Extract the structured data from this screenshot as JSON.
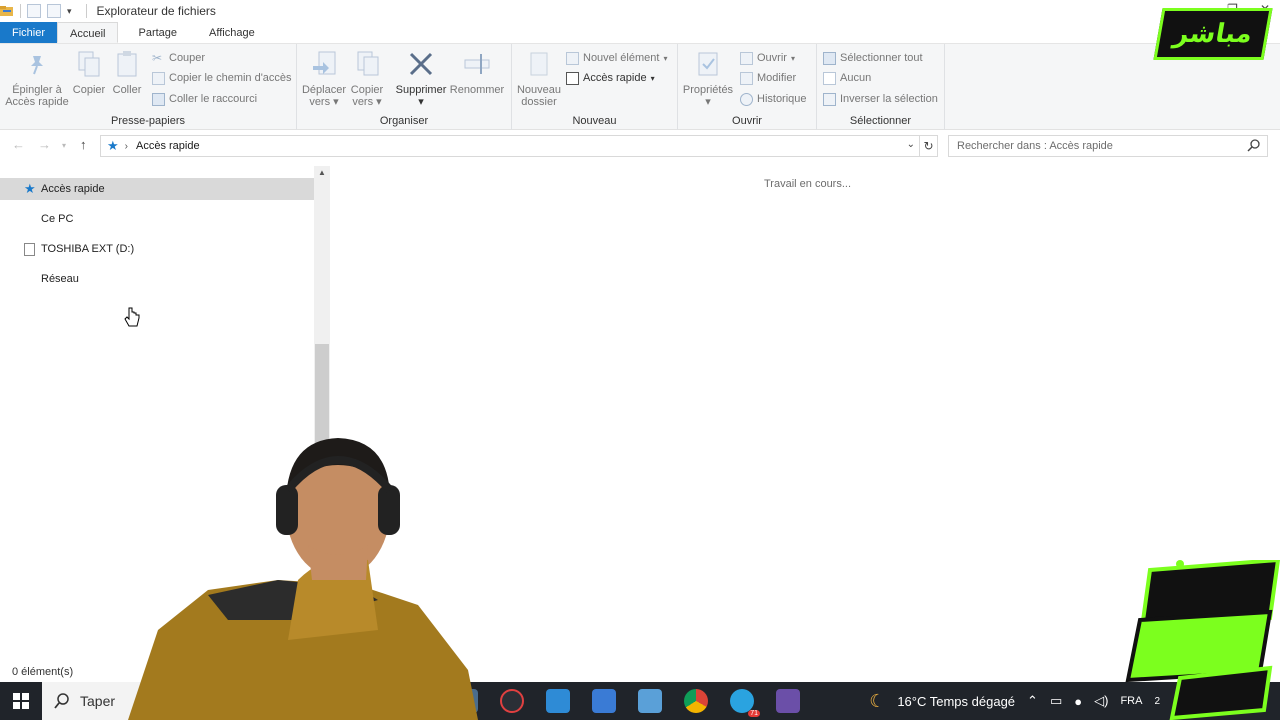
{
  "window": {
    "title": "Explorateur de fichiers"
  },
  "tabs": [
    {
      "label": "Fichier"
    },
    {
      "label": "Accueil"
    },
    {
      "label": "Partage"
    },
    {
      "label": "Affichage"
    }
  ],
  "ribbon": {
    "presse_papiers": {
      "label": "Presse-papiers",
      "pin_label_1": "Épingler à",
      "pin_label_2": "Accès rapide",
      "copy": "Copier",
      "paste": "Coller",
      "cut": "Couper",
      "copy_path": "Copier le chemin d'accès",
      "paste_shortcut": "Coller le raccourci"
    },
    "organiser": {
      "label": "Organiser",
      "move_1": "Déplacer",
      "move_2": "vers",
      "copyto_1": "Copier",
      "copyto_2": "vers",
      "delete": "Supprimer",
      "rename": "Renommer"
    },
    "nouveau": {
      "label": "Nouveau",
      "new_folder_1": "Nouveau",
      "new_folder_2": "dossier",
      "new_item": "Nouvel élément",
      "easy_access": "Accès rapide"
    },
    "ouvrir": {
      "label": "Ouvrir",
      "properties": "Propriétés",
      "open": "Ouvrir",
      "edit": "Modifier",
      "history": "Historique"
    },
    "selectionner": {
      "label": "Sélectionner",
      "select_all": "Sélectionner tout",
      "select_none": "Aucun",
      "invert": "Inverser la sélection"
    }
  },
  "addressbar": {
    "path": "Accès rapide",
    "search_placeholder": "Rechercher dans : Accès rapide"
  },
  "navpane": {
    "items": [
      {
        "label": "Accès rapide"
      },
      {
        "label": "Ce PC"
      },
      {
        "label": "TOSHIBA EXT (D:)"
      },
      {
        "label": "Réseau"
      }
    ]
  },
  "content": {
    "status_message": "Travail en cours..."
  },
  "statusbar": {
    "count": "0 élément(s)"
  },
  "taskbar": {
    "search_text": "Taper",
    "weather": "16°C  Temps dégagé",
    "language": "FRA",
    "telegram_badge": "71",
    "clock": "2"
  },
  "overlay": {
    "top_logo": "مباشر"
  },
  "colors": {
    "file_tab": "#1979ca",
    "ribbon_bg": "#f5f6f7",
    "selection": "#d9d9d9",
    "overlay_green": "#7cff1e",
    "taskbar": "#20242a"
  }
}
